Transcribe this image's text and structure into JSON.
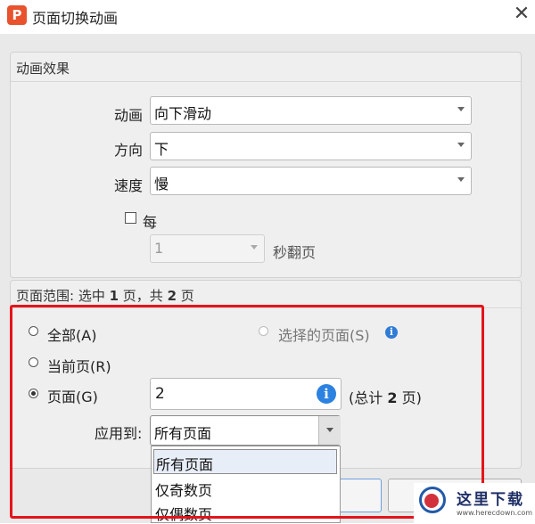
{
  "window": {
    "app_icon": "P",
    "title": "页面切换动画",
    "close_glyph": "✕"
  },
  "effects_group": {
    "title": "动画效果",
    "animation": {
      "label": "动画",
      "value": "向下滑动"
    },
    "direction": {
      "label": "方向",
      "value": "下"
    },
    "speed": {
      "label": "速度",
      "value": "慢"
    },
    "auto_flip": {
      "checkbox_label": "每",
      "checked": false,
      "seconds_value": "1",
      "suffix": "秒翻页"
    }
  },
  "range_group": {
    "title_prefix": "页面范围: 选中 ",
    "selected_count": "1",
    "title_middle": " 页，共 ",
    "total_count": "2",
    "title_suffix": " 页",
    "options": {
      "all": "全部(A)",
      "selected_pages": "选择的页面(S)",
      "current_page": "当前页(R)",
      "pages": "页面(G)"
    },
    "pages_input_value": "2",
    "total_prefix": "(总计 ",
    "total_value": "2",
    "total_suffix": " 页)",
    "apply_to": {
      "label": "应用到:",
      "value": "所有页面",
      "options": [
        "所有页面",
        "仅奇数页",
        "仅偶数页"
      ]
    }
  },
  "icons": {
    "info": "i",
    "checked_radio": "pages"
  },
  "watermark": {
    "text": "这里下载",
    "url": "www.herecdown.com"
  },
  "colors": {
    "highlight_border": "#e4141c",
    "info_icon": "#2f7bd6",
    "app_icon": "#e8522c"
  }
}
